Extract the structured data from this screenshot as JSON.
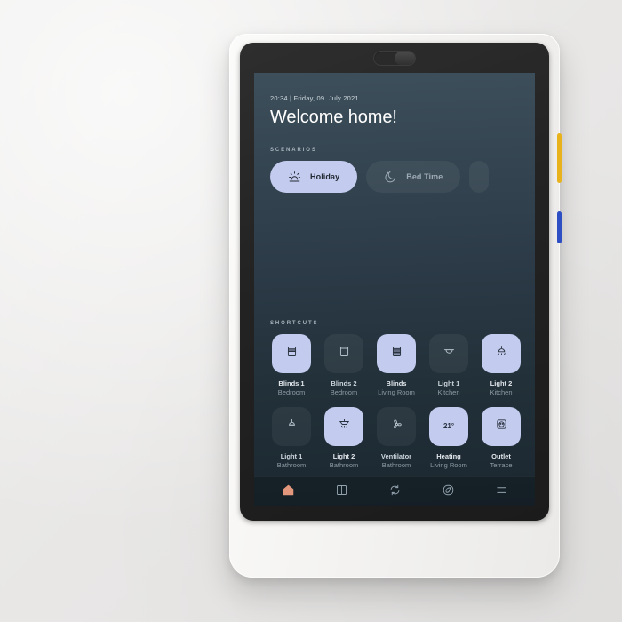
{
  "device": {
    "name": "smart-home-wall-tablet",
    "body_color": "#f4f3f1",
    "bezel_color": "#232323",
    "side_buttons": [
      {
        "name": "yellow-side-button",
        "color": "#e8b21c"
      },
      {
        "name": "blue-side-button",
        "color": "#2e4fc4"
      }
    ],
    "camera_privacy_slider": "camera-shutter-slider"
  },
  "theme": {
    "screen_gradient_top": "#3d4f5b",
    "screen_gradient_bottom": "#1b2730",
    "accent_lavender": "#c3cbee",
    "accent_home": "#e2977c",
    "text_primary": "#ffffff",
    "text_muted": "#8e9ca6",
    "wall_background": "#ecebea"
  },
  "header": {
    "time": "20:34",
    "separator": "|",
    "date": "Friday, 09. July 2021",
    "timestamp_line": "20:34  |  Friday, 09. July 2021",
    "greeting": "Welcome home!"
  },
  "scenarios": {
    "label": "SCENARIOS",
    "items": [
      {
        "label": "Holiday",
        "icon": "sunrise-icon",
        "active": true
      },
      {
        "label": "Bed Time",
        "icon": "moon-icon",
        "active": false
      },
      {
        "label": "",
        "icon": "partial-icon",
        "active": false
      }
    ]
  },
  "shortcuts": {
    "label": "SHORTCUTS",
    "items": [
      {
        "name": "Blinds 1",
        "room": "Bedroom",
        "icon": "blinds-half-icon",
        "on": true,
        "value": ""
      },
      {
        "name": "Blinds 2",
        "room": "Bedroom",
        "icon": "blinds-open-icon",
        "on": false,
        "value": ""
      },
      {
        "name": "Blinds",
        "room": "Living Room",
        "icon": "blinds-closed-icon",
        "on": true,
        "value": ""
      },
      {
        "name": "Light 1",
        "room": "Kitchen",
        "icon": "ceiling-lamp-icon",
        "on": false,
        "value": ""
      },
      {
        "name": "Light 2",
        "room": "Kitchen",
        "icon": "pendant-lamp-icon",
        "on": true,
        "value": ""
      },
      {
        "name": "Light 1",
        "room": "Bathroom",
        "icon": "ceiling-lamp-icon",
        "on": false,
        "value": ""
      },
      {
        "name": "Light 2",
        "room": "Bathroom",
        "icon": "spotlight-icon",
        "on": true,
        "value": ""
      },
      {
        "name": "Ventilator",
        "room": "Bathroom",
        "icon": "fan-icon",
        "on": false,
        "value": ""
      },
      {
        "name": "Heating",
        "room": "Living Room",
        "icon": "temperature-text",
        "on": true,
        "value": "21°"
      },
      {
        "name": "Outlet",
        "room": "Terrace",
        "icon": "power-socket-icon",
        "on": true,
        "value": ""
      }
    ]
  },
  "navbar": {
    "items": [
      {
        "name": "home",
        "icon": "home-icon",
        "active": true
      },
      {
        "name": "rooms",
        "icon": "grid-icon",
        "active": false
      },
      {
        "name": "automations",
        "icon": "sync-icon",
        "active": false
      },
      {
        "name": "energy",
        "icon": "leaf-icon",
        "active": false
      },
      {
        "name": "menu",
        "icon": "hamburger-menu-icon",
        "active": false
      }
    ]
  }
}
